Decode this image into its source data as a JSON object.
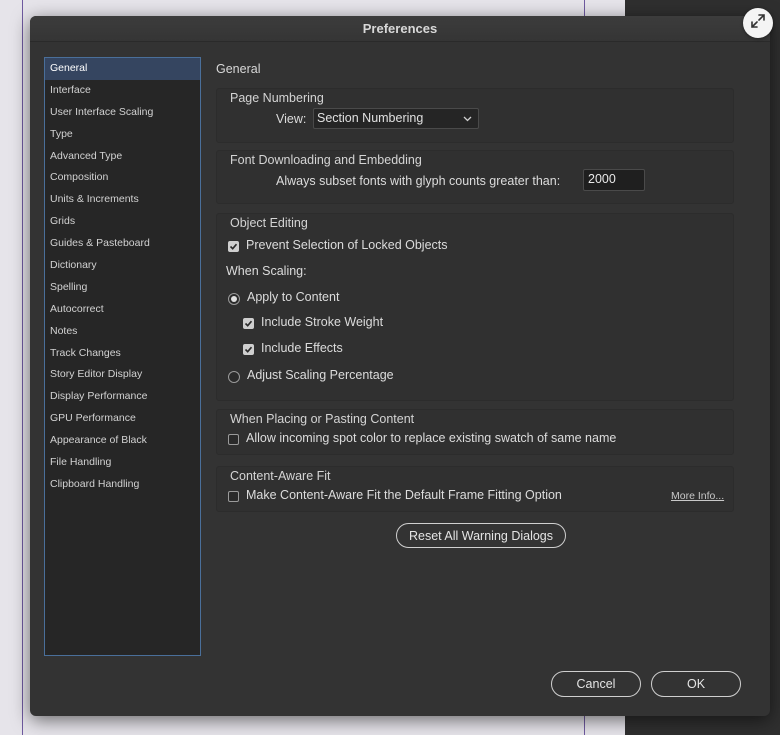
{
  "dialog": {
    "title": "Preferences"
  },
  "sidebar": {
    "items": [
      {
        "label": "General"
      },
      {
        "label": "Interface"
      },
      {
        "label": "User Interface Scaling"
      },
      {
        "label": "Type"
      },
      {
        "label": "Advanced Type"
      },
      {
        "label": "Composition"
      },
      {
        "label": "Units & Increments"
      },
      {
        "label": "Grids"
      },
      {
        "label": "Guides & Pasteboard"
      },
      {
        "label": "Dictionary"
      },
      {
        "label": "Spelling"
      },
      {
        "label": "Autocorrect"
      },
      {
        "label": "Notes"
      },
      {
        "label": "Track Changes"
      },
      {
        "label": "Story Editor Display"
      },
      {
        "label": "Display Performance"
      },
      {
        "label": "GPU Performance"
      },
      {
        "label": "Appearance of Black"
      },
      {
        "label": "File Handling"
      },
      {
        "label": "Clipboard Handling"
      }
    ],
    "selected": "General"
  },
  "main": {
    "title": "General",
    "page_numbering": {
      "title": "Page Numbering",
      "view_label": "View:",
      "view_value": "Section Numbering"
    },
    "font_downloading": {
      "title": "Font Downloading and Embedding",
      "subset_label": "Always subset fonts with glyph counts greater than:",
      "subset_value": "2000"
    },
    "object_editing": {
      "title": "Object Editing",
      "prevent_selection_label": "Prevent Selection of Locked Objects",
      "prevent_selection_checked": true,
      "when_scaling_label": "When Scaling:",
      "apply_to_content_label": "Apply to Content",
      "apply_to_content_selected": true,
      "include_stroke_label": "Include Stroke Weight",
      "include_stroke_checked": true,
      "include_effects_label": "Include Effects",
      "include_effects_checked": true,
      "adjust_scaling_label": "Adjust Scaling Percentage",
      "adjust_scaling_selected": false
    },
    "placing": {
      "title": "When Placing or Pasting Content",
      "spot_color_label": "Allow incoming spot color to replace existing swatch of same name",
      "spot_color_checked": false
    },
    "content_aware": {
      "title": "Content-Aware Fit",
      "default_label": "Make Content-Aware Fit the Default Frame Fitting Option",
      "default_checked": false,
      "more_info_label": "More Info..."
    },
    "reset_warnings_label": "Reset All Warning Dialogs"
  },
  "footer": {
    "cancel_label": "Cancel",
    "ok_label": "OK"
  },
  "icons": {
    "expand": "expand-icon",
    "dropdown": "chevron-down-icon",
    "check": "checkmark-icon"
  },
  "colors": {
    "dialog_bg": "#333333",
    "sidebar_bg": "#262626",
    "selection": "#354560",
    "sidebar_border": "#4a6f9a"
  }
}
